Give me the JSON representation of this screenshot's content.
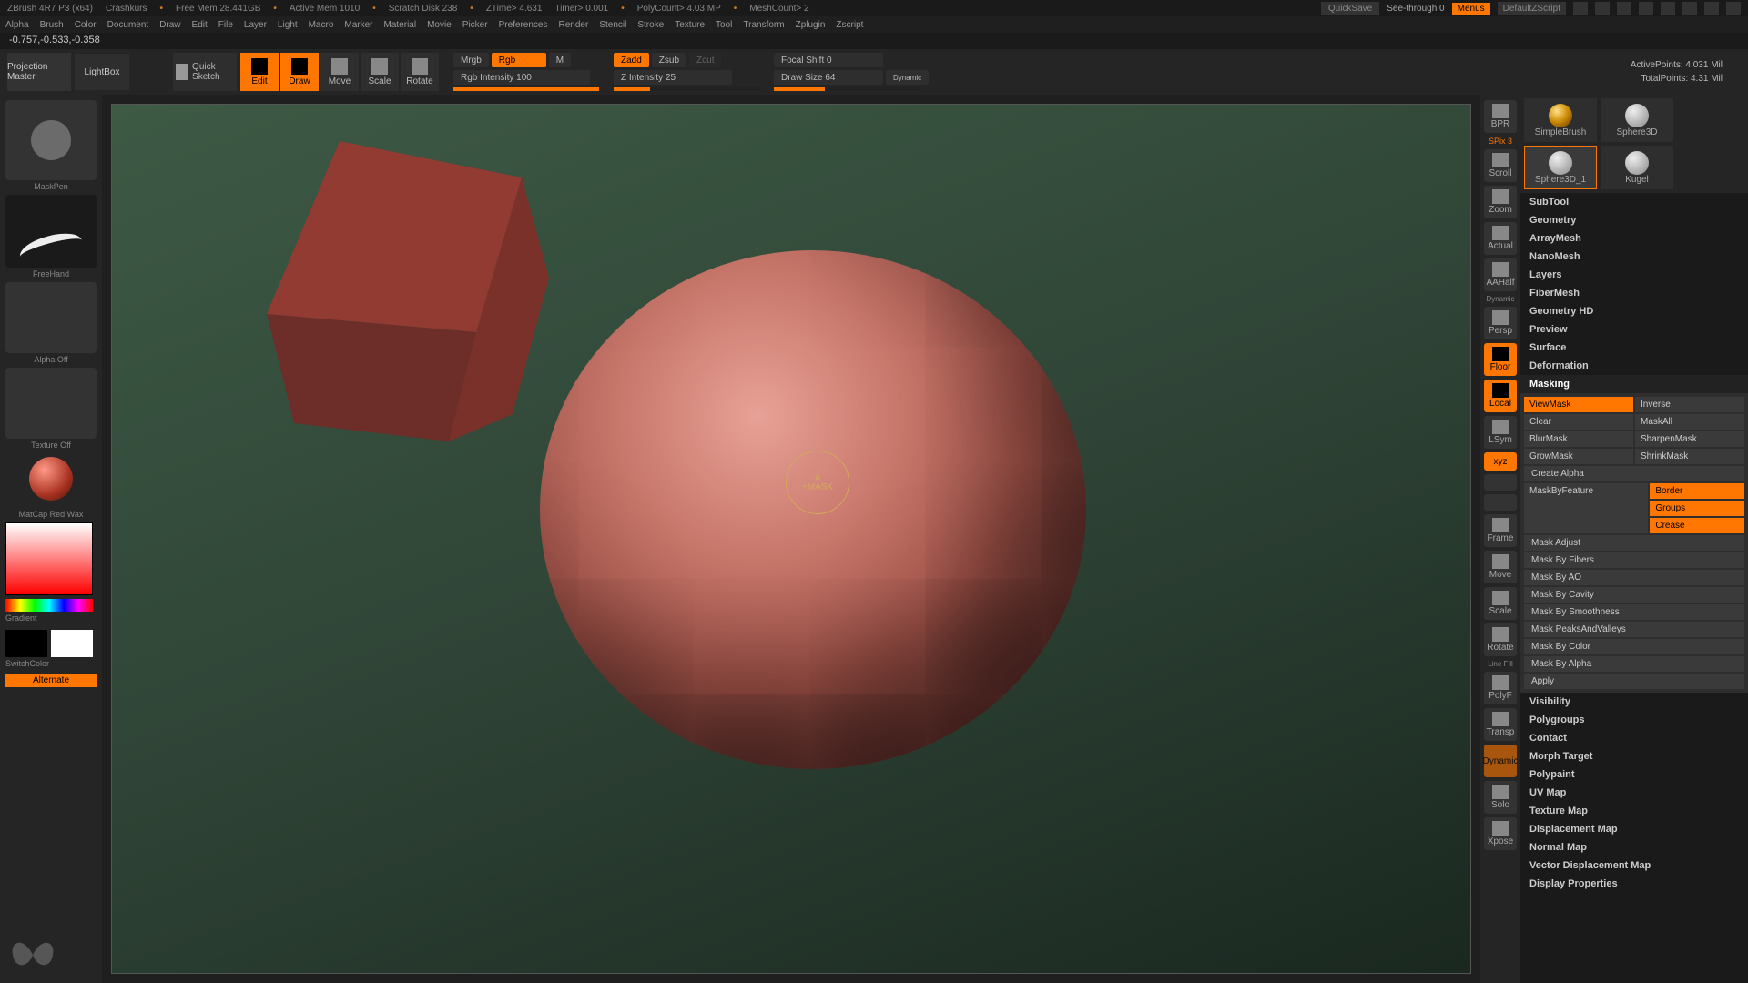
{
  "title_bar": {
    "app": "ZBrush 4R7 P3 (x64)",
    "project": "Crashkurs",
    "free_mem": "Free Mem 28.441GB",
    "active_mem": "Active Mem 1010",
    "scratch": "Scratch Disk 238",
    "ztime": "ZTime> 4.631",
    "timer": "Timer> 0.001",
    "polycount": "PolyCount> 4.03 MP",
    "meshcount": "MeshCount> 2",
    "quicksave": "QuickSave",
    "seethrough": "See-through  0",
    "menus": "Menus",
    "script": "DefaultZScript"
  },
  "menu": [
    "Alpha",
    "Brush",
    "Color",
    "Document",
    "Draw",
    "Edit",
    "File",
    "Layer",
    "Light",
    "Macro",
    "Marker",
    "Material",
    "Movie",
    "Picker",
    "Preferences",
    "Render",
    "Stencil",
    "Stroke",
    "Texture",
    "Tool",
    "Transform",
    "Zplugin",
    "Zscript"
  ],
  "status": "-0.757,-0.533,-0.358",
  "toolbar": {
    "projection": "Projection Master",
    "lightbox": "LightBox",
    "qsketch": "Quick Sketch",
    "modes": [
      "Edit",
      "Draw",
      "Move",
      "Scale",
      "Rotate"
    ],
    "mrgb": "Mrgb",
    "rgb": "Rgb",
    "m": "M",
    "rgb_intensity": "Rgb Intensity 100",
    "zadd": "Zadd",
    "zsub": "Zsub",
    "zcut": "Zcut",
    "z_intensity": "Z Intensity 25",
    "focal": "Focal Shift 0",
    "draw_size": "Draw Size 64",
    "dynamic": "Dynamic",
    "active_pts": "ActivePoints: 4.031 Mil",
    "total_pts": "TotalPoints: 4.31 Mil"
  },
  "left": {
    "brush": "MaskPen",
    "stroke": "FreeHand",
    "alpha": "Alpha Off",
    "texture": "Texture Off",
    "material": "MatCap Red Wax",
    "gradient": "Gradient",
    "switchcolor": "SwitchColor",
    "alternate": "Alternate"
  },
  "cursor": {
    "a": "a",
    "mask": "+MASK"
  },
  "vstrip": [
    "BPR",
    "SPix 3",
    "Scroll",
    "Zoom",
    "Actual",
    "AAHalf",
    "Dynamic",
    "Persp",
    "Floor",
    "Local",
    "LSym",
    "xyz",
    "",
    "",
    "Frame",
    "Move",
    "Scale",
    "Rotate",
    "Line Fill",
    "PolyF",
    "Transp",
    "Dynamic",
    "Solo",
    "Xpose"
  ],
  "tools": {
    "thumbs": [
      "SimpleBrush",
      "Sphere3D",
      "Sphere3D_1",
      "Kugel"
    ]
  },
  "panels": [
    "SubTool",
    "Geometry",
    "ArrayMesh",
    "NanoMesh",
    "Layers",
    "FiberMesh",
    "Geometry HD",
    "Preview",
    "Surface",
    "Deformation"
  ],
  "masking": {
    "title": "Masking",
    "viewmask": "ViewMask",
    "inverse": "Inverse",
    "clear": "Clear",
    "maskall": "MaskAll",
    "blurmask": "BlurMask",
    "sharpenmask": "SharpenMask",
    "growmask": "GrowMask",
    "shrinkmask": "ShrinkMask",
    "create_alpha": "Create Alpha",
    "maskbyfeature": "MaskByFeature",
    "border": "Border",
    "groups": "Groups",
    "crease": "Crease",
    "items": [
      "Mask Adjust",
      "Mask By Fibers",
      "Mask By AO",
      "Mask By Cavity",
      "Mask By Smoothness",
      "Mask PeaksAndValleys",
      "Mask By Color",
      "Mask By Alpha",
      "Apply"
    ]
  },
  "panels2": [
    "Visibility",
    "Polygroups",
    "Contact",
    "Morph Target",
    "Polypaint",
    "UV Map",
    "Texture Map",
    "Displacement Map",
    "Normal Map",
    "Vector Displacement Map",
    "Display Properties"
  ]
}
